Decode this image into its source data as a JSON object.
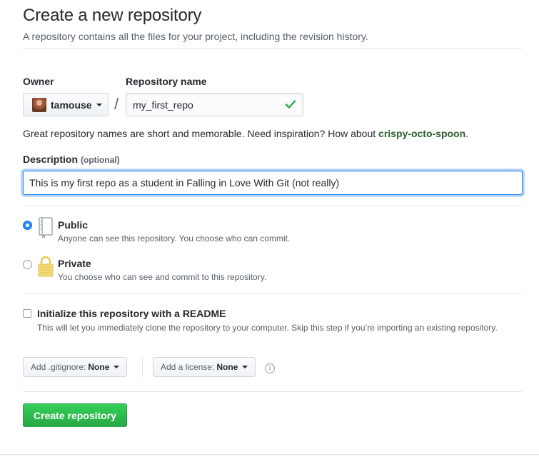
{
  "header": {
    "title": "Create a new repository",
    "subtitle": "A repository contains all the files for your project, including the revision history."
  },
  "owner": {
    "label": "Owner",
    "value": "tamouse"
  },
  "separator": "/",
  "repo_name": {
    "label": "Repository name",
    "value": "my_first_repo",
    "valid": true
  },
  "hint": {
    "text": "Great repository names are short and memorable. Need inspiration? How about ",
    "suggestion": "crispy-octo-spoon",
    "end": "."
  },
  "description": {
    "label": "Description",
    "optional": "(optional)",
    "value": "This is my first repo as a student in Falling in Love With Git (not really)"
  },
  "visibility": {
    "selected": "public",
    "public": {
      "title": "Public",
      "desc": "Anyone can see this repository. You choose who can commit."
    },
    "private": {
      "title": "Private",
      "desc": "You choose who can see and commit to this repository."
    }
  },
  "readme": {
    "checked": false,
    "title": "Initialize this repository with a README",
    "desc": "This will let you immediately clone the repository to your computer. Skip this step if you’re importing an existing repository."
  },
  "gitignore": {
    "label": "Add .gitignore:",
    "value": "None"
  },
  "license": {
    "label": "Add a license:",
    "value": "None"
  },
  "info_glyph": "i",
  "submit": {
    "label": "Create repository"
  },
  "colors": {
    "accent": "#2188ff",
    "success": "#28a745",
    "suggestion": "#2c5e2e"
  }
}
